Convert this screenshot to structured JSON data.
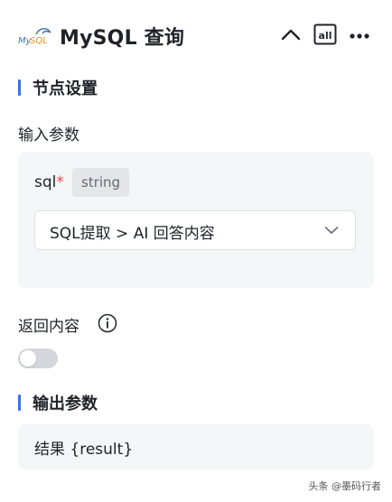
{
  "header": {
    "title": "MySQL 查询",
    "logo_text": "MySQL",
    "all_label": "all"
  },
  "node_settings": {
    "section_title": "节点设置",
    "input_params_label": "输入参数",
    "param": {
      "name": "sql",
      "required_mark": "*",
      "type": "string",
      "selected_value": "SQL提取 > AI 回答内容"
    },
    "return_content_label": "返回内容",
    "return_content_enabled": false
  },
  "output": {
    "section_title": "输出参数",
    "value": "结果 {result}"
  },
  "watermark": "头条 @墨码行者",
  "colors": {
    "accent": "#3370ff",
    "required": "#f54a45",
    "card_bg": "#f5f6f7"
  },
  "icons": [
    "mysql-logo",
    "chevron-up-icon",
    "all-icon",
    "more-icon",
    "chevron-down-icon",
    "info-icon"
  ]
}
